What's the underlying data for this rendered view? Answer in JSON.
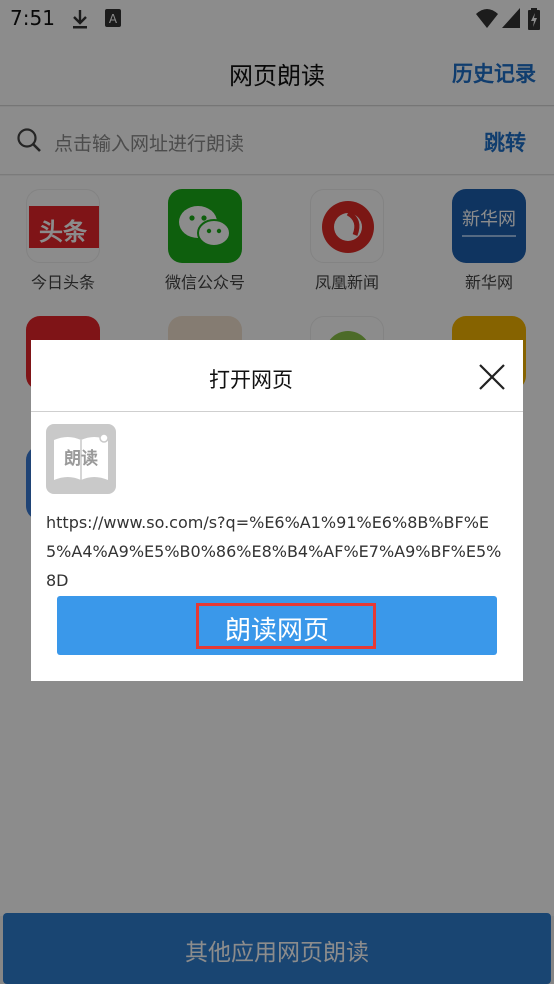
{
  "status_bar": {
    "time": "7:51",
    "download_icon": "download-icon",
    "notification_icon": "text-notification-icon",
    "wifi_icon": "wifi-icon",
    "signal_icon": "signal-icon",
    "battery_icon": "battery-charging-icon"
  },
  "header": {
    "title": "网页朗读",
    "history_label": "历史记录"
  },
  "search": {
    "placeholder": "点击输入网址进行朗读",
    "jump_label": "跳转"
  },
  "apps": [
    {
      "label": "今日头条",
      "tile_text": "头条",
      "color": "#e8262a"
    },
    {
      "label": "微信公众号",
      "tile_text": "",
      "color": "#1aad19"
    },
    {
      "label": "凤凰新闻",
      "tile_text": "",
      "color": "#e02a26"
    },
    {
      "label": "新华网",
      "tile_text": "新华网",
      "color": "#1d5fb0"
    }
  ],
  "dialog": {
    "title": "打开网页",
    "book_icon_text": "朗读",
    "url": "https://www.so.com/s?q=%E6%A1%91%E6%8B%BF%E5%A4%A9%E5%B0%86%E8%B4%AF%E7%A9%BF%E5%8D",
    "read_button_label": "朗读网页"
  },
  "bottom_button_label": "其他应用网页朗读",
  "colors": {
    "accent_blue": "#1e6fc8",
    "button_blue": "#3a98ea",
    "highlight_red": "#e53935"
  }
}
